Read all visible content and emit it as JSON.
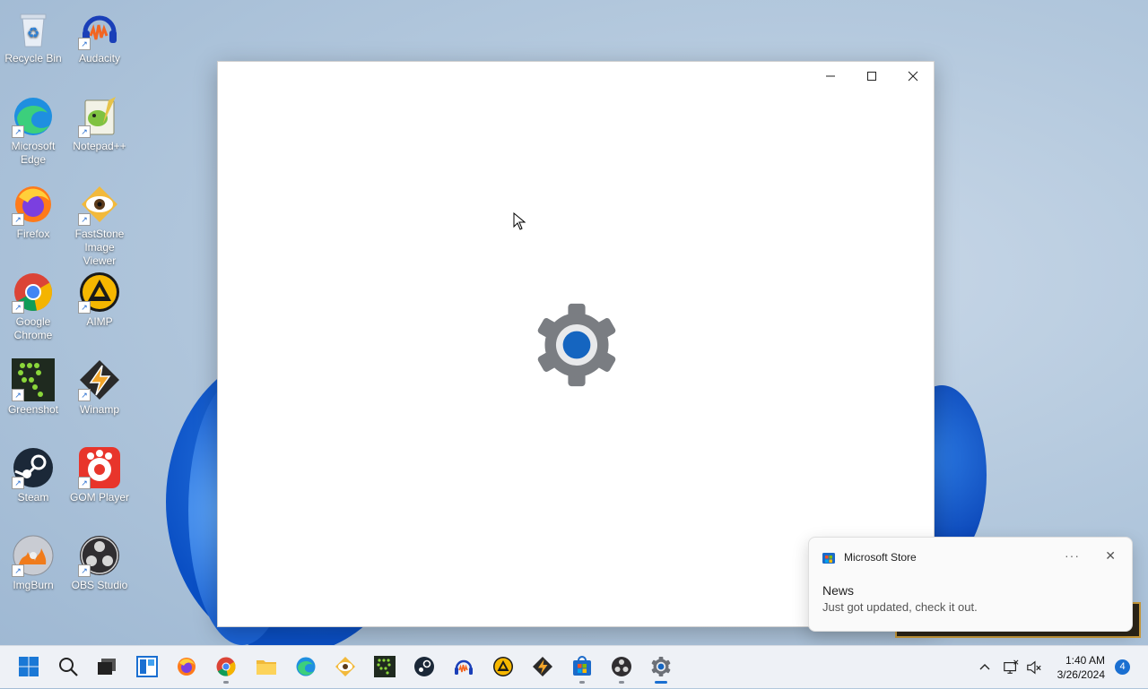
{
  "desktop": {
    "icons": [
      {
        "label": "Recycle Bin",
        "icon": "recycle-bin-icon"
      },
      {
        "label": "Audacity",
        "icon": "audacity-icon"
      },
      {
        "label": "Microsoft Edge",
        "icon": "edge-icon"
      },
      {
        "label": "Notepad++",
        "icon": "notepad-plus-plus-icon"
      },
      {
        "label": "Firefox",
        "icon": "firefox-icon"
      },
      {
        "label": "FastStone Image Viewer",
        "icon": "faststone-icon"
      },
      {
        "label": "Google Chrome",
        "icon": "chrome-icon"
      },
      {
        "label": "AIMP",
        "icon": "aimp-icon"
      },
      {
        "label": "Greenshot",
        "icon": "greenshot-icon"
      },
      {
        "label": "Winamp",
        "icon": "winamp-icon"
      },
      {
        "label": "Steam",
        "icon": "steam-icon"
      },
      {
        "label": "GOM Player",
        "icon": "gom-player-icon"
      },
      {
        "label": "ImgBurn",
        "icon": "imgburn-icon"
      },
      {
        "label": "OBS Studio",
        "icon": "obs-studio-icon"
      }
    ]
  },
  "window": {
    "app": "Settings",
    "state": "loading",
    "splash_icon": "settings-gear-icon",
    "controls": {
      "minimize": "minimize-icon",
      "maximize": "maximize-icon",
      "close": "close-icon"
    }
  },
  "toast": {
    "app_name": "Microsoft Store",
    "title": "News",
    "body": "Just got updated, check it out.",
    "more_label": "···",
    "close_label": "✕"
  },
  "taskbar": {
    "apps": [
      {
        "icon": "start-icon"
      },
      {
        "icon": "search-icon"
      },
      {
        "icon": "task-view-icon"
      },
      {
        "icon": "widgets-icon"
      },
      {
        "icon": "firefox-icon"
      },
      {
        "icon": "chrome-icon",
        "running": true
      },
      {
        "icon": "file-explorer-icon"
      },
      {
        "icon": "edge-icon"
      },
      {
        "icon": "faststone-icon"
      },
      {
        "icon": "greenshot-icon"
      },
      {
        "icon": "steam-icon"
      },
      {
        "icon": "audacity-icon"
      },
      {
        "icon": "aimp-icon"
      },
      {
        "icon": "winamp-icon"
      },
      {
        "icon": "microsoft-store-icon",
        "running": true
      },
      {
        "icon": "obs-studio-icon",
        "running": true
      },
      {
        "icon": "settings-icon",
        "active": true
      }
    ],
    "clock": {
      "time": "1:40 AM",
      "date": "3/26/2024"
    },
    "notification_count": "4"
  },
  "colors": {
    "accent": "#1a6fd1",
    "gear": "#7a7d82"
  }
}
